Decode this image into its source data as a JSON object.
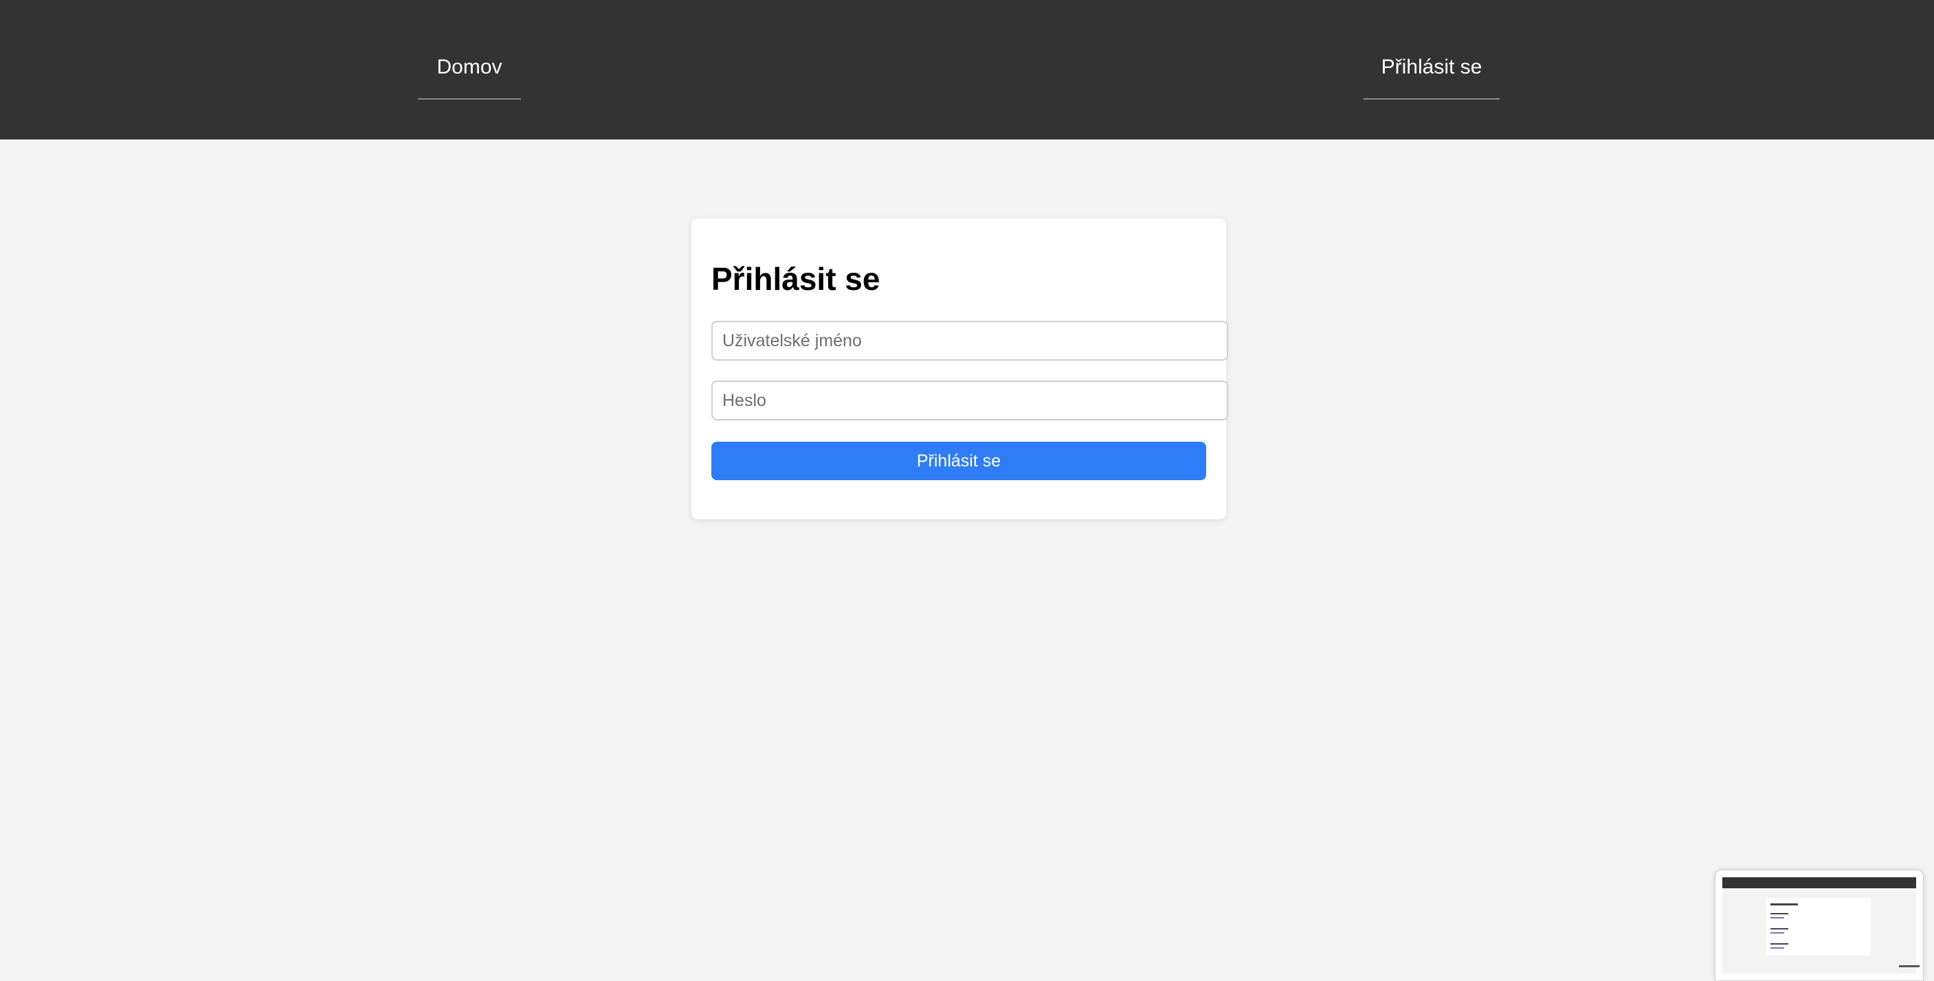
{
  "nav": {
    "home_label": "Domov",
    "login_label": "Přihlásit se"
  },
  "login_form": {
    "title": "Přihlásit se",
    "username_placeholder": "Uživatelské jméno",
    "password_placeholder": "Heslo",
    "submit_label": "Přihlásit se"
  },
  "colors": {
    "topbar": "#333333",
    "background": "#f3f3f3",
    "primary_button": "#2f7df6"
  }
}
